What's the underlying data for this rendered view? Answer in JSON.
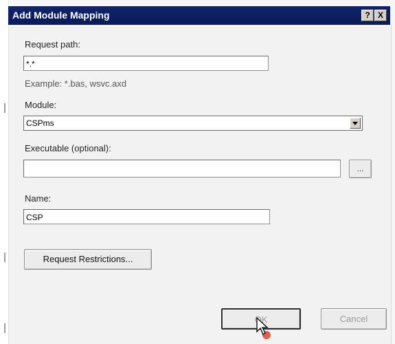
{
  "dialog": {
    "title": "Add Module Mapping",
    "help_label": "?",
    "close_label": "X"
  },
  "request_path": {
    "label": "Request path:",
    "value": "*.*",
    "example": "Example: *.bas, wsvc.axd"
  },
  "module": {
    "label": "Module:",
    "value": "CSPms"
  },
  "executable": {
    "label": "Executable (optional):",
    "value": "",
    "browse_label": "..."
  },
  "name": {
    "label": "Name:",
    "value": "CSP"
  },
  "buttons": {
    "request_restrictions": "Request Restrictions...",
    "ok": "OK",
    "cancel": "Cancel"
  },
  "icons": {
    "cursor": "mouse-pointer-icon",
    "dropdown": "chevron-down-icon"
  }
}
